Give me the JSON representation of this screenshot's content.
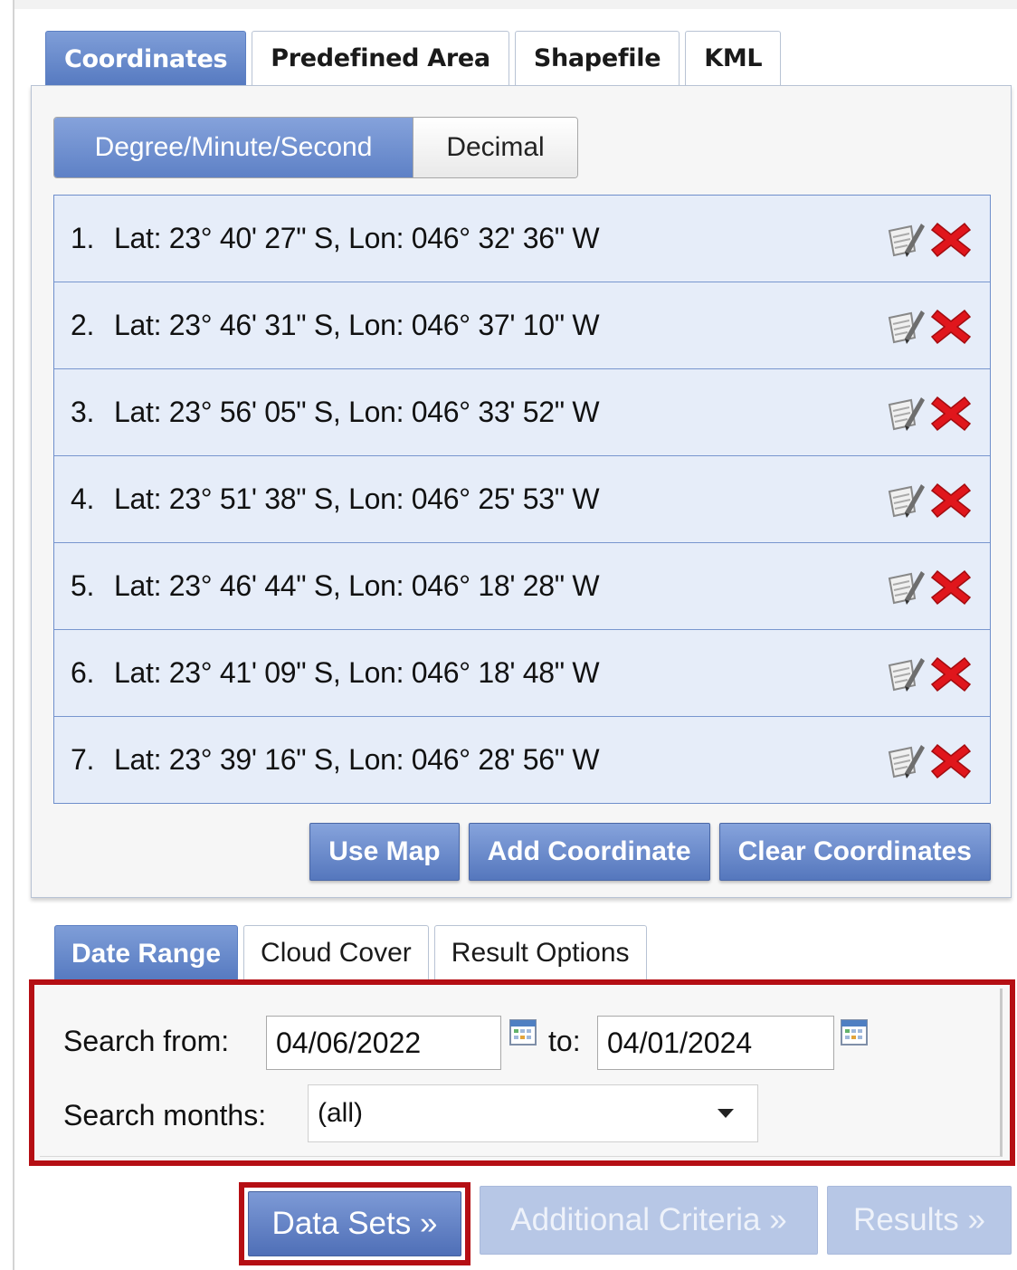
{
  "tabs_top": [
    "Coordinates",
    "Predefined Area",
    "Shapefile",
    "KML"
  ],
  "format_toggle": {
    "active": "Degree/Minute/Second",
    "inactive": "Decimal"
  },
  "coordinates": [
    {
      "num": "1.",
      "text": "Lat: 23° 40' 27\" S, Lon: 046° 32' 36\" W"
    },
    {
      "num": "2.",
      "text": "Lat: 23° 46' 31\" S, Lon: 046° 37' 10\" W"
    },
    {
      "num": "3.",
      "text": "Lat: 23° 56' 05\" S, Lon: 046° 33' 52\" W"
    },
    {
      "num": "4.",
      "text": "Lat: 23° 51' 38\" S, Lon: 046° 25' 53\" W"
    },
    {
      "num": "5.",
      "text": "Lat: 23° 46' 44\" S, Lon: 046° 18' 28\" W"
    },
    {
      "num": "6.",
      "text": "Lat: 23° 41' 09\" S, Lon: 046° 18' 48\" W"
    },
    {
      "num": "7.",
      "text": "Lat: 23° 39' 16\" S, Lon: 046° 28' 56\" W"
    }
  ],
  "coord_actions": {
    "use_map": "Use Map",
    "add": "Add Coordinate",
    "clear": "Clear Coordinates"
  },
  "tabs_bottom": [
    "Date Range",
    "Cloud Cover",
    "Result Options"
  ],
  "date_range": {
    "search_from_label": "Search from:",
    "from_value": "04/06/2022",
    "to_label": "to:",
    "to_value": "04/01/2024",
    "months_label": "Search months:",
    "months_value": "(all)"
  },
  "nav": {
    "data_sets": "Data Sets »",
    "additional": "Additional Criteria »",
    "results": "Results »"
  },
  "icons": {
    "edit": "edit-note-icon",
    "delete": "red-x-delete-icon",
    "calendar": "calendar-icon"
  },
  "colors": {
    "accent": "#5e81c6",
    "highlight": "#b50f14",
    "row_bg": "#e6edf9",
    "delete_red": "#e0161c"
  }
}
